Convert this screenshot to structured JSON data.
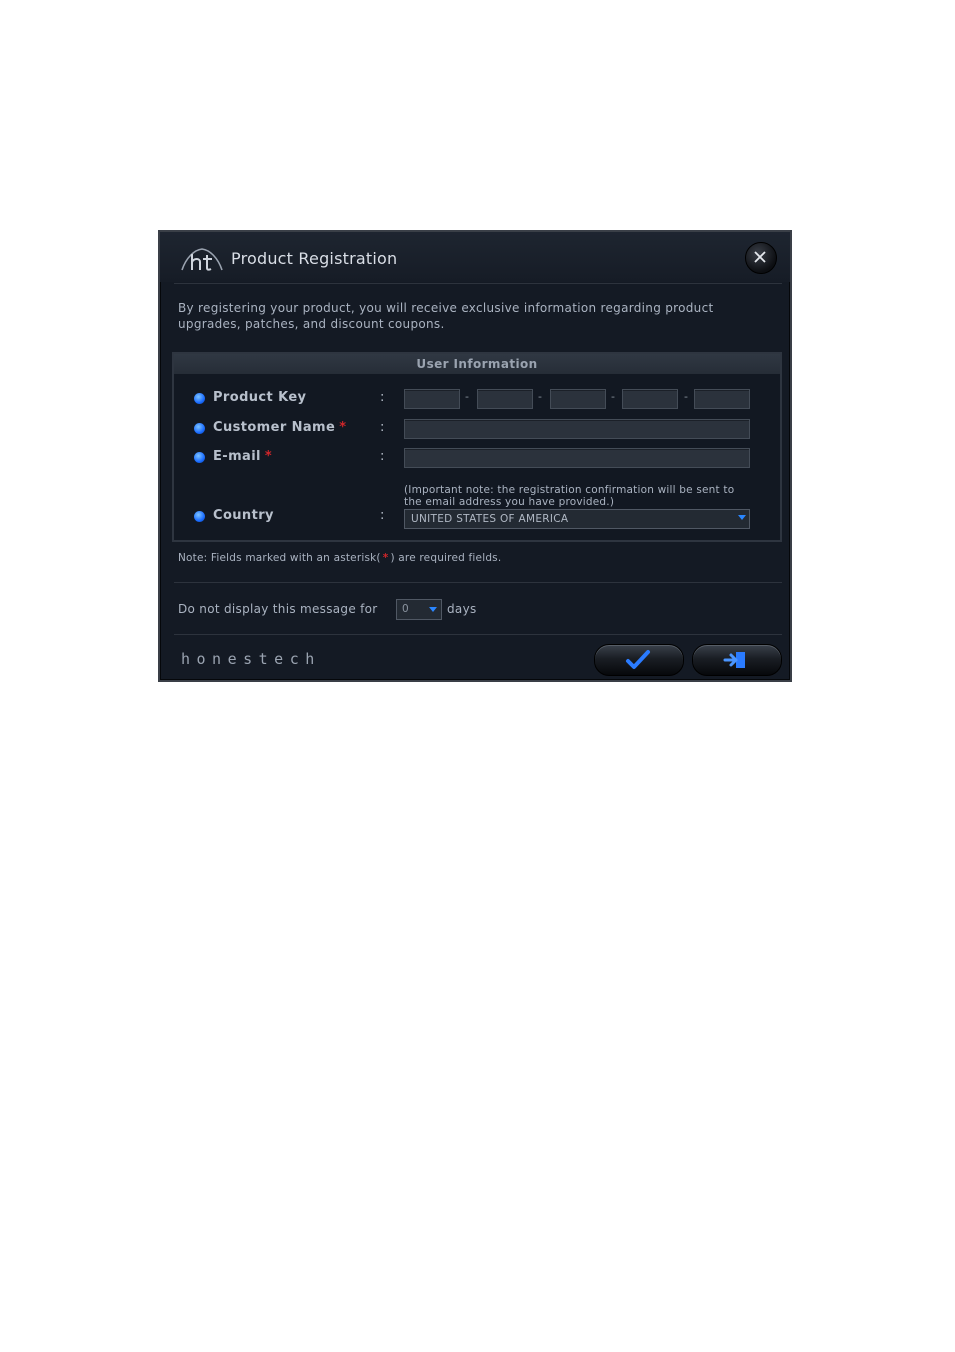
{
  "window": {
    "title": "Product Registration",
    "close_icon": "close-icon",
    "logo_icon": "ht-logo-icon"
  },
  "intro_text": "By registering your product, you will receive exclusive information regarding product upgrades, patches, and discount coupons.",
  "user_info": {
    "header": "User Information",
    "fields": {
      "product_key": {
        "label": "Product Key",
        "segments": [
          "",
          "",
          "",
          "",
          ""
        ],
        "separator": "-"
      },
      "customer_name": {
        "label": "Customer Name",
        "value": "",
        "required_marker": "*"
      },
      "email": {
        "label": "E-mail",
        "value": "",
        "required_marker": "*",
        "note": "(Important note: the registration confirmation will be sent to the email address you have provided.)"
      },
      "country": {
        "label": "Country",
        "selected": "UNITED STATES OF AMERICA"
      }
    },
    "colon": ":"
  },
  "required_note": {
    "prefix": "Note: Fields marked with an asterisk(",
    "marker": "*",
    "suffix": ") are required fields."
  },
  "dont_display": {
    "prefix": "Do not display this message for",
    "selected_days": "0",
    "suffix": "days"
  },
  "footer": {
    "brand": "honestech",
    "ok_icon": "checkmark-icon",
    "exit_icon": "exit-icon"
  },
  "colors": {
    "background": "#141a24",
    "accent_blue": "#1a6cff",
    "required_red": "#d0262a",
    "text": "#aab3c1"
  }
}
